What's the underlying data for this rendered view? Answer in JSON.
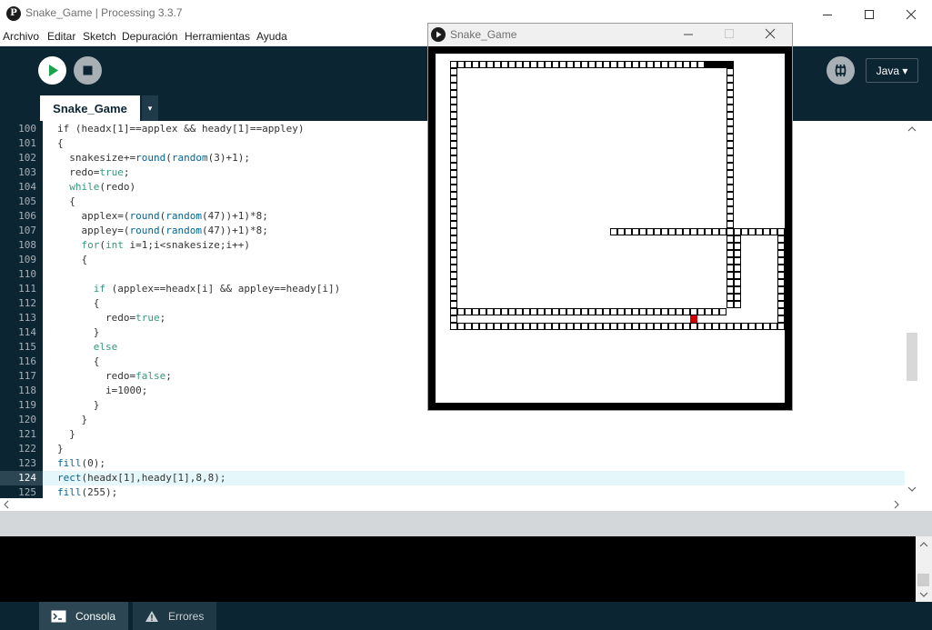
{
  "window": {
    "title": "Snake_Game | Processing 3.3.7",
    "logo_glyph": "P3",
    "minimize_icon": "minimize-icon",
    "maximize_icon": "maximize-icon",
    "close_icon": "close-icon"
  },
  "menu": [
    "Archivo",
    "Editar",
    "Sketch",
    "Depuración",
    "Herramientas",
    "Ayuda"
  ],
  "toolbar": {
    "run_icon": "play-icon",
    "stop_icon": "stop-icon",
    "debug_icon": "debugger-icon",
    "mode_label": "Java ▾"
  },
  "tabs": {
    "active": "Snake_Game",
    "menu_glyph": "▾"
  },
  "editor": {
    "current_line": 124,
    "lines": [
      {
        "n": 100,
        "html": "<span>if (headx[1]==applex &amp;&amp; heady[1]==appley)</span>"
      },
      {
        "n": 101,
        "html": "<span>{</span>"
      },
      {
        "n": 102,
        "html": "  snakesize+=<span class=\"fn\">round</span>(<span class=\"fn\">random</span>(3)+1);"
      },
      {
        "n": 103,
        "html": "  redo=<span class=\"lit\">true</span>;"
      },
      {
        "n": 104,
        "html": "  <span class=\"kw\">while</span>(redo)"
      },
      {
        "n": 105,
        "html": "  {"
      },
      {
        "n": 106,
        "html": "    applex=(<span class=\"fn\">round</span>(<span class=\"fn\">random</span>(47))+1)*8;"
      },
      {
        "n": 107,
        "html": "    appley=(<span class=\"fn\">round</span>(<span class=\"fn\">random</span>(47))+1)*8;"
      },
      {
        "n": 108,
        "html": "    <span class=\"kw\">for</span>(<span class=\"kw\">int</span> i=1;i&lt;snakesize;i++)"
      },
      {
        "n": 109,
        "html": "    {"
      },
      {
        "n": 110,
        "html": ""
      },
      {
        "n": 111,
        "html": "      <span class=\"kw\">if</span> (applex==headx[i] &amp;&amp; appley==heady[i])"
      },
      {
        "n": 112,
        "html": "      {"
      },
      {
        "n": 113,
        "html": "        redo=<span class=\"lit\">true</span>;"
      },
      {
        "n": 114,
        "html": "      }"
      },
      {
        "n": 115,
        "html": "      <span class=\"kw\">else</span>"
      },
      {
        "n": 116,
        "html": "      {"
      },
      {
        "n": 117,
        "html": "        redo=<span class=\"lit\">false</span>;"
      },
      {
        "n": 118,
        "html": "        i=1000;"
      },
      {
        "n": 119,
        "html": "      }"
      },
      {
        "n": 120,
        "html": "    }"
      },
      {
        "n": 121,
        "html": "  }"
      },
      {
        "n": 122,
        "html": "}"
      },
      {
        "n": 123,
        "html": "<span class=\"fn\">fill</span>(0);"
      },
      {
        "n": 124,
        "html": "<span class=\"fn\">rect</span>(headx[1],heady[1],8,8);"
      },
      {
        "n": 125,
        "html": "<span class=\"fn\">fill</span>(255);"
      }
    ]
  },
  "console": {
    "tab_console": "Consola",
    "tab_errors": "Errores",
    "console_icon": "console-icon",
    "errors_icon": "warning-icon"
  },
  "sketch": {
    "title": "Snake_Game",
    "grid_cells": 48,
    "apple": {
      "col": 35,
      "row": 36
    },
    "snake_top_wall": {
      "row": 1,
      "from": 2,
      "to": 36
    },
    "head_segment_black": {
      "row": 1,
      "from": 37,
      "to": 40
    }
  },
  "colors": {
    "toolbar_bg": "#0b2533",
    "apple": "#cc0000",
    "highlight_line": "#e5f7fa"
  }
}
